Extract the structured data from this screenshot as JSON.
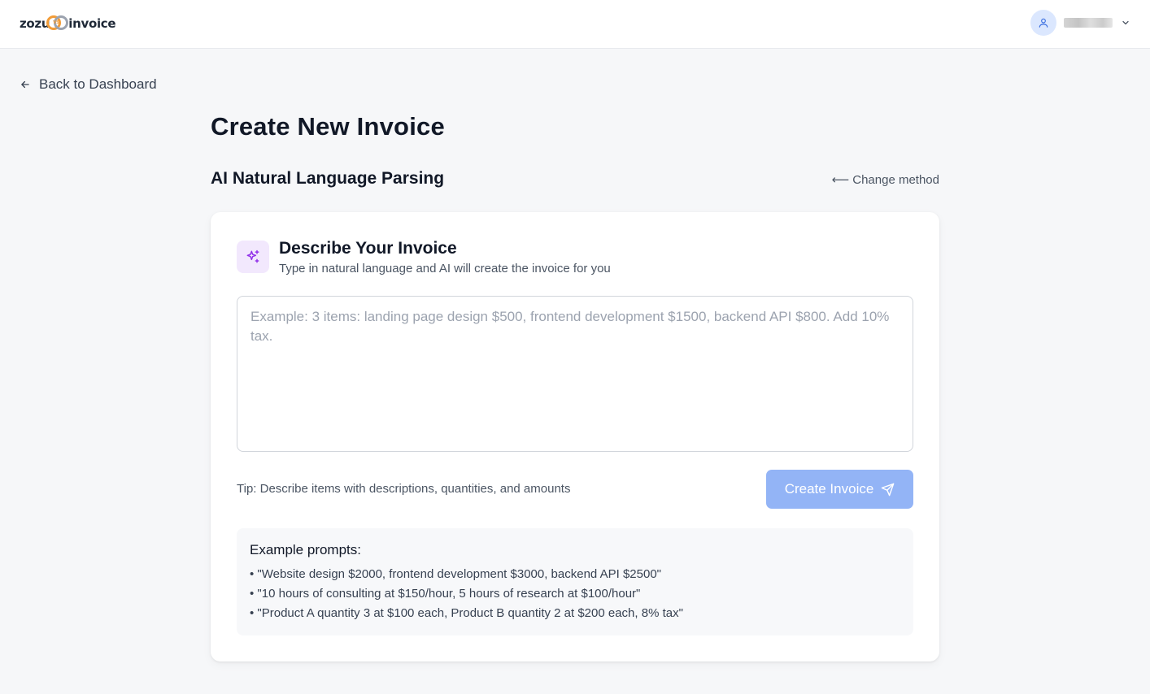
{
  "header": {
    "logo_left": "zozu",
    "logo_mark": "vs",
    "logo_right": "invoice",
    "user_icon": "user-icon",
    "menu_icon": "chevron-down-icon"
  },
  "nav": {
    "back_label": "Back to Dashboard"
  },
  "page": {
    "title": "Create New Invoice",
    "section_title": "AI Natural Language Parsing",
    "change_method_label": "Change method",
    "change_method_arrow": "⟵"
  },
  "card": {
    "title": "Describe Your Invoice",
    "subtitle": "Type in natural language and AI will create the invoice for you",
    "input_value": "",
    "input_placeholder": "Example: 3 items: landing page design $500, frontend development $1500, backend API $800. Add 10% tax.",
    "tip": "Tip: Describe items with descriptions, quantities, and amounts",
    "create_button_label": "Create Invoice",
    "examples_title": "Example prompts:",
    "examples": [
      "• \"Website design $2000, frontend development $3000, backend API $2500\"",
      "• \"10 hours of consulting at $150/hour, 5 hours of research at $100/hour\"",
      "• \"Product A quantity 3 at $100 each, Product B quantity 2 at $200 each, 8% tax\""
    ]
  },
  "colors": {
    "accent_button": "#93b4f6",
    "sparkle_bg": "#f2e8fd",
    "sparkle_icon": "#9333ea",
    "avatar_bg": "#dbe7fe",
    "logo_orange": "#f29c38"
  }
}
